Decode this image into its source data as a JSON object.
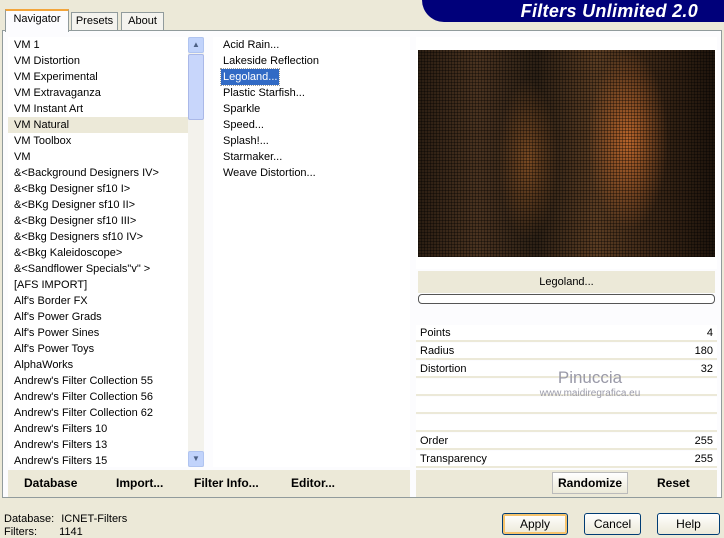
{
  "app_title": "Filters Unlimited 2.0",
  "tabs": [
    "Navigator",
    "Presets",
    "About"
  ],
  "categories": [
    "VM 1",
    "VM Distortion",
    "VM Experimental",
    "VM Extravaganza",
    "VM Instant Art",
    "VM Natural",
    "VM Toolbox",
    "VM",
    "&<Background Designers IV>",
    "&<Bkg Designer sf10 I>",
    "&<BKg Designer sf10 II>",
    "&<Bkg Designer sf10 III>",
    "&<Bkg Designers sf10 IV>",
    "&<Bkg Kaleidoscope>",
    "&<Sandflower Specials\"v\" >",
    "[AFS IMPORT]",
    "Alf's Border FX",
    "Alf's Power Grads",
    "Alf's Power Sines",
    "Alf's Power Toys",
    "AlphaWorks",
    "Andrew's Filter Collection 55",
    "Andrew's Filter Collection 56",
    "Andrew's Filter Collection 62",
    "Andrew's Filters 10",
    "Andrew's Filters 13",
    "Andrew's Filters 15"
  ],
  "selected_category": 5,
  "filters": [
    "Acid Rain...",
    "Lakeside Reflection",
    "Legoland...",
    "Plastic Starfish...",
    "Sparkle",
    "Speed...",
    "Splash!...",
    "Starmaker...",
    "Weave Distortion..."
  ],
  "selected_filter": 2,
  "preview_title": "Legoland...",
  "progress": 0,
  "params": [
    {
      "label": "Points",
      "value": "4"
    },
    {
      "label": "Radius",
      "value": "180"
    },
    {
      "label": "Distortion",
      "value": "32"
    },
    {
      "label": "",
      "value": ""
    },
    {
      "label": "",
      "value": ""
    },
    {
      "label": "",
      "value": ""
    },
    {
      "label": "Order",
      "value": "255"
    },
    {
      "label": "Transparency",
      "value": "255"
    }
  ],
  "watermark": {
    "name": "Pinuccia",
    "url": "www.maidiregrafica.eu"
  },
  "toolbar": {
    "database": "Database",
    "import": "Import...",
    "filter_info": "Filter Info...",
    "editor": "Editor...",
    "randomize": "Randomize",
    "reset": "Reset"
  },
  "status": {
    "database_label": "Database:",
    "database_value": "ICNET-Filters",
    "filters_label": "Filters:",
    "filters_value": "1141"
  },
  "buttons": {
    "apply": "Apply",
    "cancel": "Cancel",
    "help": "Help"
  }
}
